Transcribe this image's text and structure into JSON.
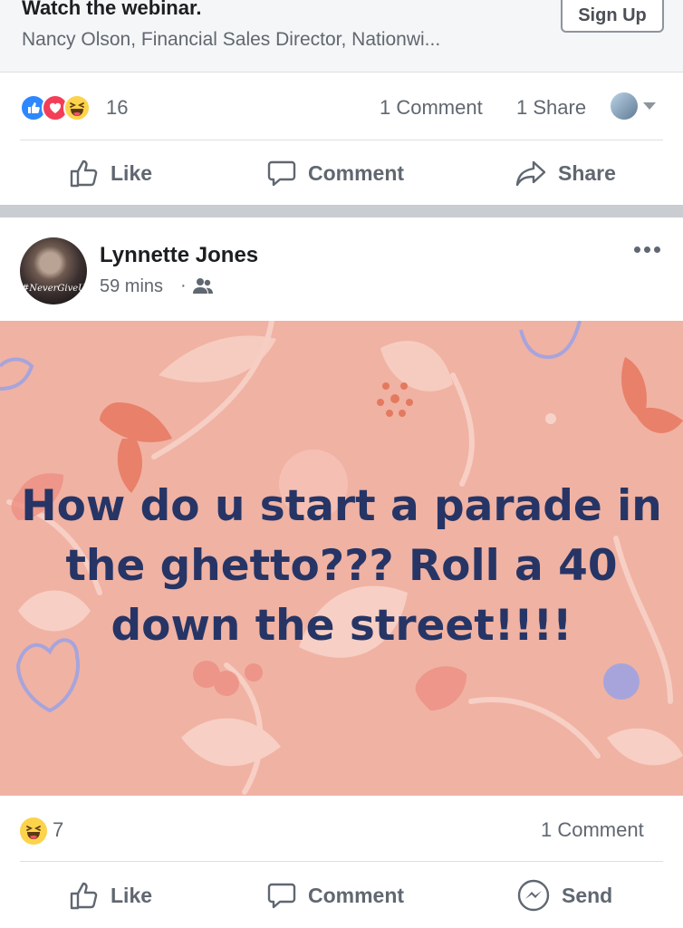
{
  "ad": {
    "title": "Watch the webinar.",
    "description": "Nancy Olson, Financial Sales Director, Nationwi...",
    "cta_label": "Sign Up"
  },
  "post1": {
    "reaction_count": "16",
    "comments": "1 Comment",
    "shares": "1 Share",
    "actions": {
      "like": "Like",
      "comment": "Comment",
      "share": "Share"
    }
  },
  "post2": {
    "author": "Lynnette Jones",
    "avatar_caption": "#NeverGiveUp",
    "time": "59 mins",
    "separator": "·",
    "audience_icon": "friends-icon",
    "body_text": "How do u start a parade in the ghetto??? Roll a 40 down the street!!!!",
    "background_color": "#f0b2a3",
    "text_color": "#263565",
    "reaction_count": "7",
    "comments": "1 Comment",
    "actions": {
      "like": "Like",
      "comment": "Comment",
      "send": "Send"
    }
  }
}
